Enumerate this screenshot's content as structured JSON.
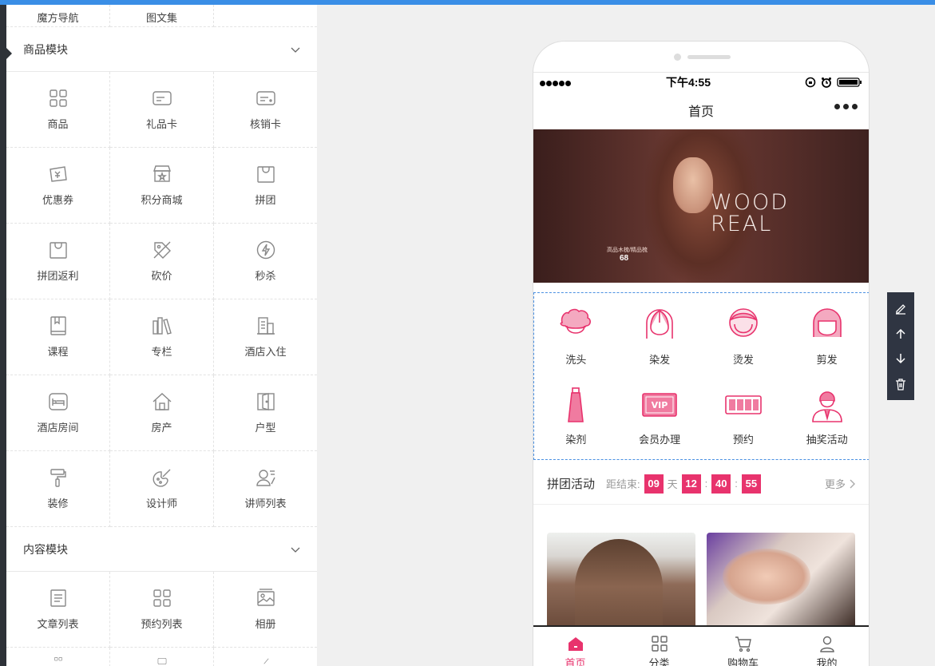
{
  "top_partial": [
    "魔方导航",
    "图文集",
    ""
  ],
  "goods_section": {
    "title": "商品模块",
    "items": [
      {
        "label": "商品",
        "icon": "grid-icon"
      },
      {
        "label": "礼品卡",
        "icon": "card-icon"
      },
      {
        "label": "核销卡",
        "icon": "card-icon"
      },
      {
        "label": "优惠券",
        "icon": "coupon-icon"
      },
      {
        "label": "积分商城",
        "icon": "store-icon"
      },
      {
        "label": "拼团",
        "icon": "bag-icon"
      },
      {
        "label": "拼团返利",
        "icon": "bag-icon"
      },
      {
        "label": "砍价",
        "icon": "tag-icon"
      },
      {
        "label": "秒杀",
        "icon": "flash-icon"
      },
      {
        "label": "课程",
        "icon": "book-icon"
      },
      {
        "label": "专栏",
        "icon": "books-icon"
      },
      {
        "label": "酒店入住",
        "icon": "building-icon"
      },
      {
        "label": "酒店房间",
        "icon": "bed-icon"
      },
      {
        "label": "房产",
        "icon": "house-icon"
      },
      {
        "label": "户型",
        "icon": "door-icon"
      },
      {
        "label": "装修",
        "icon": "roller-icon"
      },
      {
        "label": "设计师",
        "icon": "palette-icon"
      },
      {
        "label": "讲师列表",
        "icon": "teacher-icon"
      }
    ]
  },
  "content_section": {
    "title": "内容模块",
    "items": [
      {
        "label": "文章列表",
        "icon": "article-icon"
      },
      {
        "label": "预约列表",
        "icon": "grid-icon"
      },
      {
        "label": "相册",
        "icon": "photo-icon"
      }
    ]
  },
  "phone": {
    "status": {
      "time": "下午4:55"
    },
    "nav_title": "首页",
    "banner": {
      "brand_line1": "WOOD",
      "brand_line2": "REAL",
      "caption": "高品木梳/精品梳",
      "price": "68"
    },
    "services": [
      {
        "label": "洗头",
        "icon": "wash-hair-icon"
      },
      {
        "label": "染发",
        "icon": "dye-hair-icon"
      },
      {
        "label": "烫发",
        "icon": "perm-hair-icon"
      },
      {
        "label": "剪发",
        "icon": "cut-hair-icon"
      },
      {
        "label": "染剂",
        "icon": "dye-tube-icon"
      },
      {
        "label": "会员办理",
        "icon": "vip-card-icon"
      },
      {
        "label": "预约",
        "icon": "clock-display-icon"
      },
      {
        "label": "抽奖活动",
        "icon": "person-icon"
      }
    ],
    "group_buy": {
      "title": "拼团活动",
      "countdown_label": "距结束:",
      "days": "09",
      "day_unit": "天",
      "hours": "12",
      "minutes": "40",
      "seconds": "55",
      "colon": ":",
      "more": "更多"
    },
    "tabs": [
      {
        "label": "首页",
        "icon": "home-icon",
        "active": true
      },
      {
        "label": "分类",
        "icon": "category-icon",
        "active": false
      },
      {
        "label": "购物车",
        "icon": "cart-icon",
        "active": false
      },
      {
        "label": "我的",
        "icon": "user-icon",
        "active": false
      }
    ]
  },
  "colors": {
    "accent": "#e8336d",
    "topbar": "#3a8ee6",
    "selection": "#4a90e2",
    "toolbar": "#2f3542"
  }
}
